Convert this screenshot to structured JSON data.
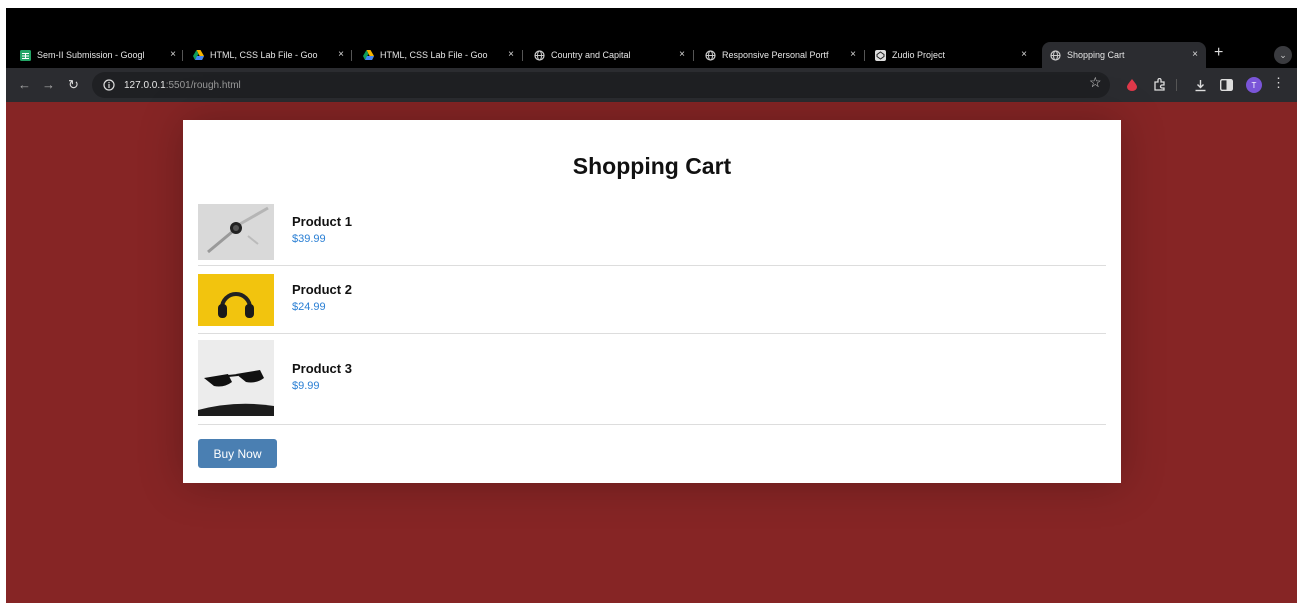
{
  "browser": {
    "tabs": [
      {
        "title": "Sem-II Submission - Googl",
        "icon": "sheets-icon"
      },
      {
        "title": "HTML, CSS Lab File - Goo",
        "icon": "drive-icon"
      },
      {
        "title": "HTML, CSS Lab File - Goo",
        "icon": "drive-icon"
      },
      {
        "title": "Country and Capital",
        "icon": "globe-icon"
      },
      {
        "title": "Responsive Personal Portf",
        "icon": "globe-icon"
      },
      {
        "title": "Zudio Project",
        "icon": "codepen-icon"
      },
      {
        "title": "Shopping Cart",
        "icon": "globe-icon",
        "active": true
      }
    ],
    "tab_close": "×",
    "new_tab": "+",
    "address": {
      "host": "127.0.0.1",
      "rest": ":5501/rough.html"
    },
    "profile_initial": "T"
  },
  "page": {
    "title": "Shopping Cart",
    "products": [
      {
        "name": "Product 1",
        "price": "$39.99",
        "image": "watch-photo"
      },
      {
        "name": "Product 2",
        "price": "$24.99",
        "image": "headphones-photo"
      },
      {
        "name": "Product 3",
        "price": "$9.99",
        "image": "sunglasses-photo"
      }
    ],
    "buy_label": "Buy Now"
  },
  "colors": {
    "page_background": "#862525",
    "card_background": "#ffffff",
    "price": "#2a7fd4",
    "button": "#4a7fb2"
  }
}
